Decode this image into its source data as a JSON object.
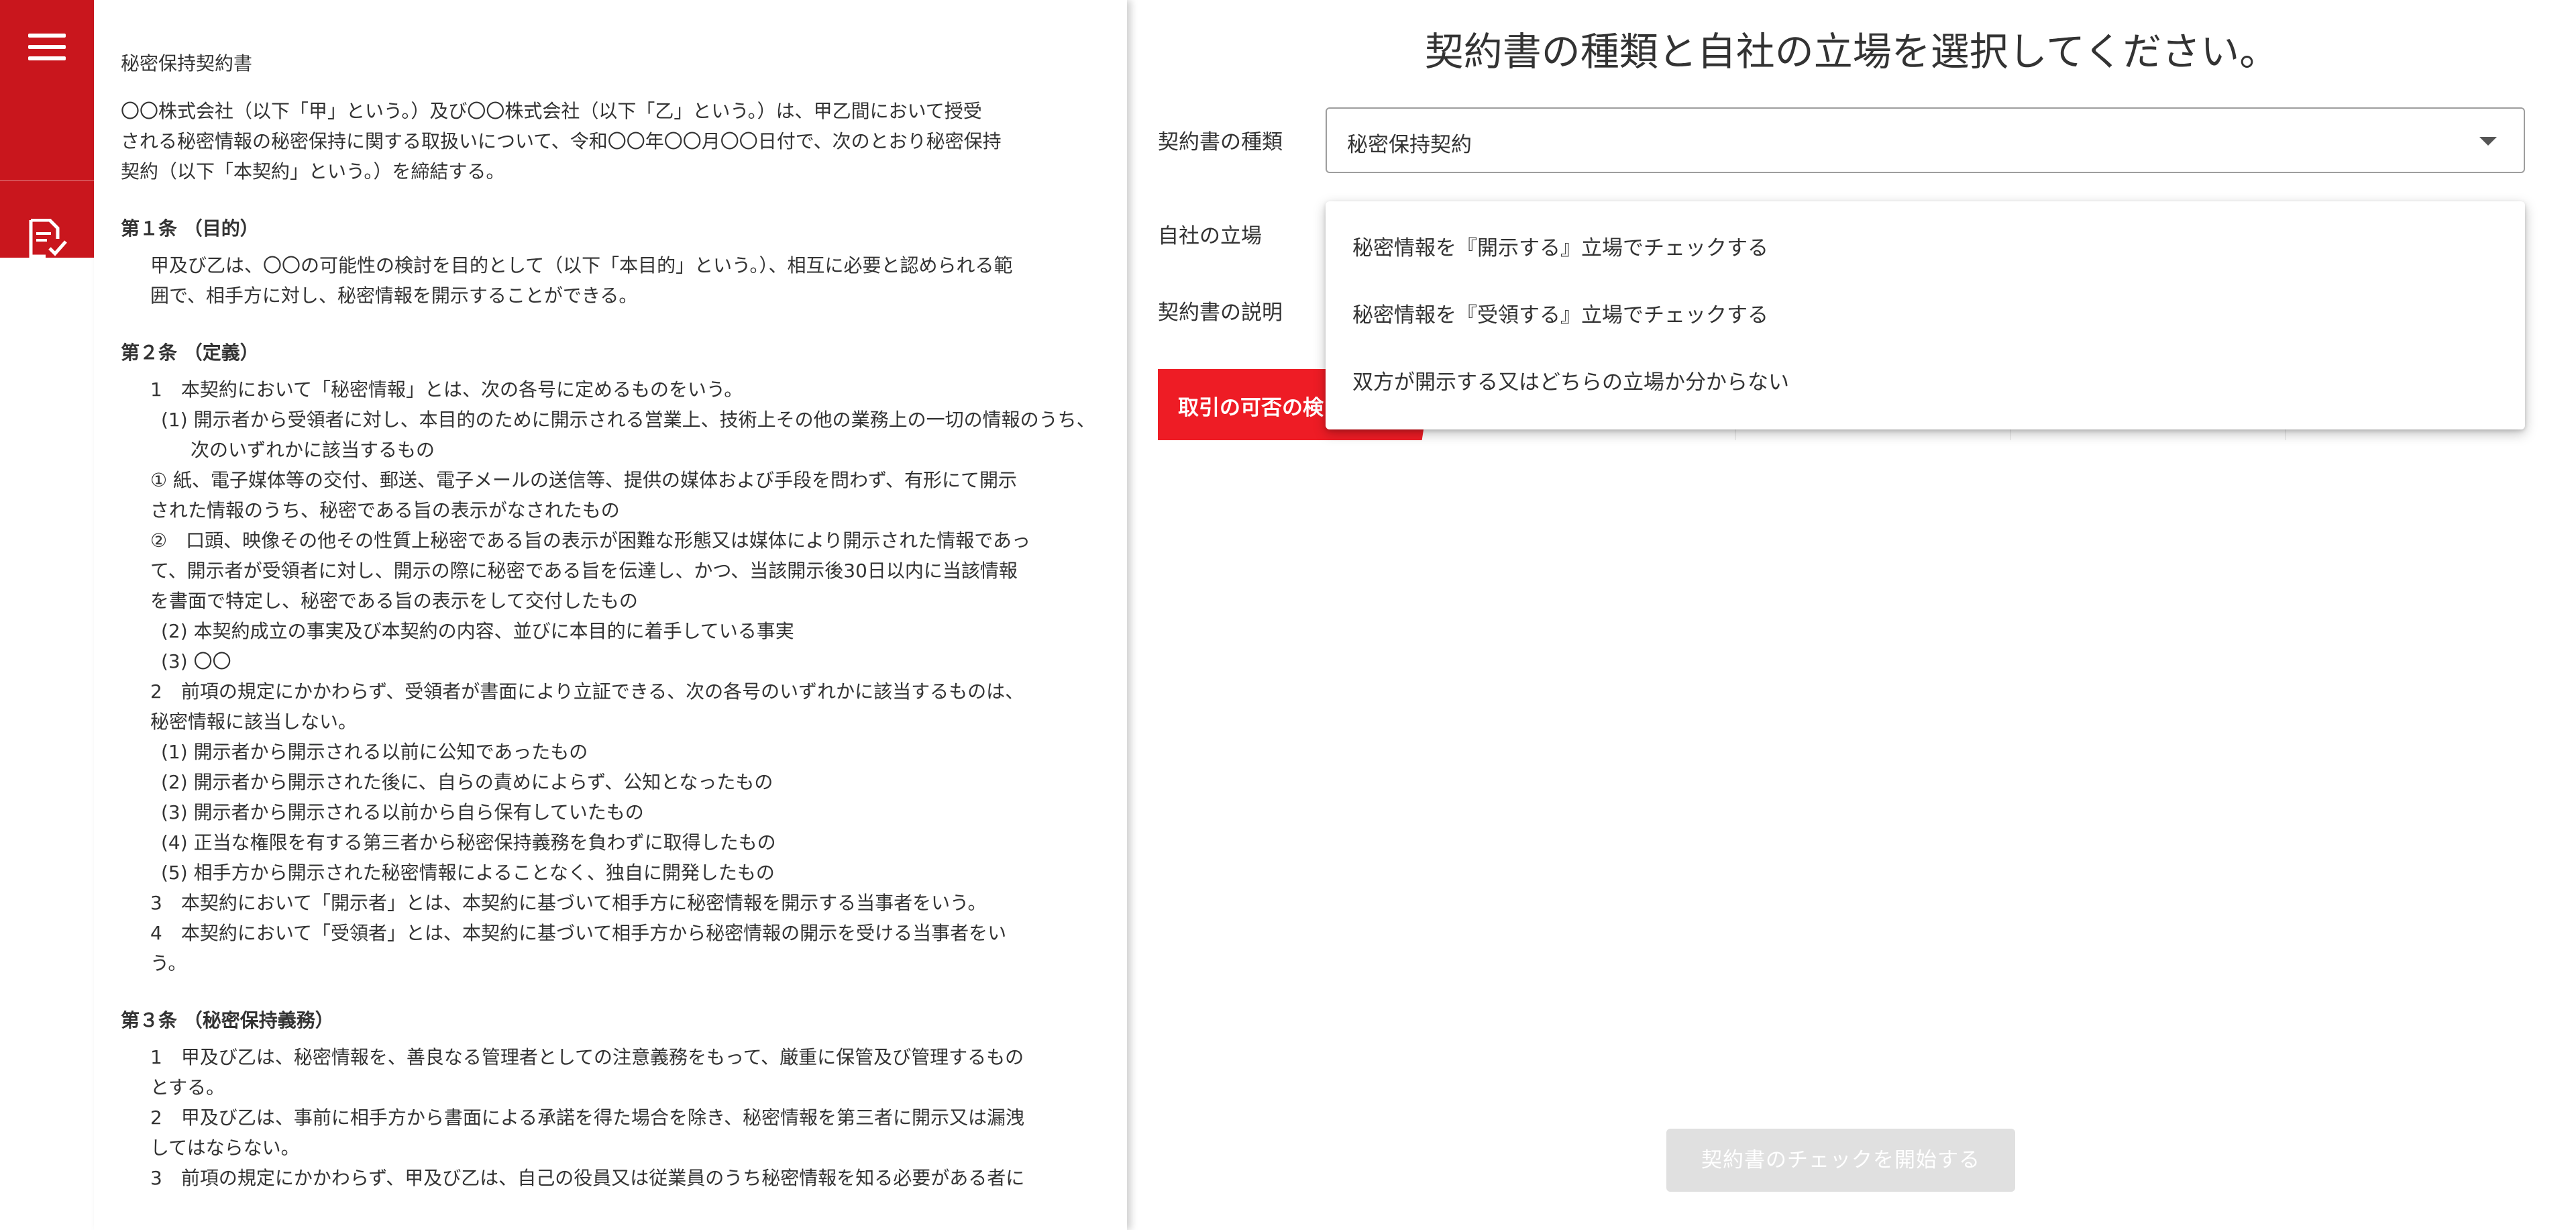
{
  "sidebar": {
    "menu_icon": "hamburger-menu-icon",
    "doc_icon": "document-check-icon",
    "colors": {
      "brand": "#c9161d"
    }
  },
  "document": {
    "title": "秘密保持契約書",
    "intro": [
      "〇〇株式会社（以下「甲」という。）及び〇〇株式会社（以下「乙」という。）は、甲乙間において授受",
      "される秘密情報の秘密保持に関する取扱いについて、令和〇〇年〇〇月〇〇日付で、次のとおり秘密保持",
      "契約（以下「本契約」という。）を締結する。"
    ],
    "article1": {
      "heading": "第１条 （目的）",
      "lines": [
        "甲及び乙は、〇〇の可能性の検討を目的として（以下「本目的」という。）、相互に必要と認められる範",
        "囲で、相手方に対し、秘密情報を開示することができる。"
      ]
    },
    "article2": {
      "heading": "第２条 （定義）",
      "p1": "1　本契約において「秘密情報」とは、次の各号に定めるものをいう。",
      "p1_item1": "(1) 開示者から受領者に対し、本目的のために開示される営業上、技術上その他の業務上の一切の情報のうち、次のいずれかに該当するもの",
      "p1_item1_a": [
        "① 紙、電子媒体等の交付、郵送、電子メールの送信等、提供の媒体および手段を問わず、有形にて開示",
        "された情報のうち、秘密である旨の表示がなされたもの"
      ],
      "p1_item1_b": [
        "②　口頭、映像その他その性質上秘密である旨の表示が困難な形態又は媒体により開示された情報であっ",
        "て、開示者が受領者に対し、開示の際に秘密である旨を伝達し、かつ、当該開示後30日以内に当該情報",
        "を書面で特定し、秘密である旨の表示をして交付したもの"
      ],
      "p1_item2": "(2) 本契約成立の事実及び本契約の内容、並びに本目的に着手している事実",
      "p1_item3": "(3) 〇〇",
      "p2": [
        "2　前項の規定にかかわらず、受領者が書面により立証できる、次の各号のいずれかに該当するものは、",
        "秘密情報に該当しない。"
      ],
      "p2_items": [
        "(1) 開示者から開示される以前に公知であったもの",
        "(2) 開示者から開示された後に、自らの責めによらず、公知となったもの",
        "(3) 開示者から開示される以前から自ら保有していたもの",
        "(4) 正当な権限を有する第三者から秘密保持義務を負わずに取得したもの",
        "(5) 相手方から開示された秘密情報によることなく、独自に開発したもの"
      ],
      "p3": "3　本契約において「開示者」とは、本契約に基づいて相手方に秘密情報を開示する当事者をいう。",
      "p4": [
        "4　本契約において「受領者」とは、本契約に基づいて相手方から秘密情報の開示を受ける当事者をい",
        "う。"
      ]
    },
    "article3": {
      "heading": "第３条 （秘密保持義務）",
      "p1": [
        "1　甲及び乙は、秘密情報を、善良なる管理者としての注意義務をもって、厳重に保管及び管理するもの",
        "とする。"
      ],
      "p2": [
        "2　甲及び乙は、事前に相手方から書面による承諾を得た場合を除き、秘密情報を第三者に開示又は漏洩",
        "してはならない。"
      ],
      "p3": "3　前項の規定にかかわらず、甲及び乙は、自己の役員又は従業員のうち秘密情報を知る必要がある者に"
    }
  },
  "form": {
    "prompt": "契約書の種類と自社の立場を選択してください。",
    "contract_type_label": "契約書の種類",
    "contract_type_value": "秘密保持契約",
    "position_label": "自社の立場",
    "description_label": "契約書の説明",
    "dropdown_icon": "caret-down-icon",
    "position_options": [
      "秘密情報を『開示する』立場でチェックする",
      "秘密情報を『受領する』立場でチェックする",
      "双方が開示する又はどちらの立場か分からない"
    ],
    "tabs": {
      "active_label": "取引の可否の検"
    },
    "start_button": "契約書のチェックを開始する",
    "colors": {
      "accent": "#ee1c25",
      "disabled": "#e0e0e0"
    }
  }
}
